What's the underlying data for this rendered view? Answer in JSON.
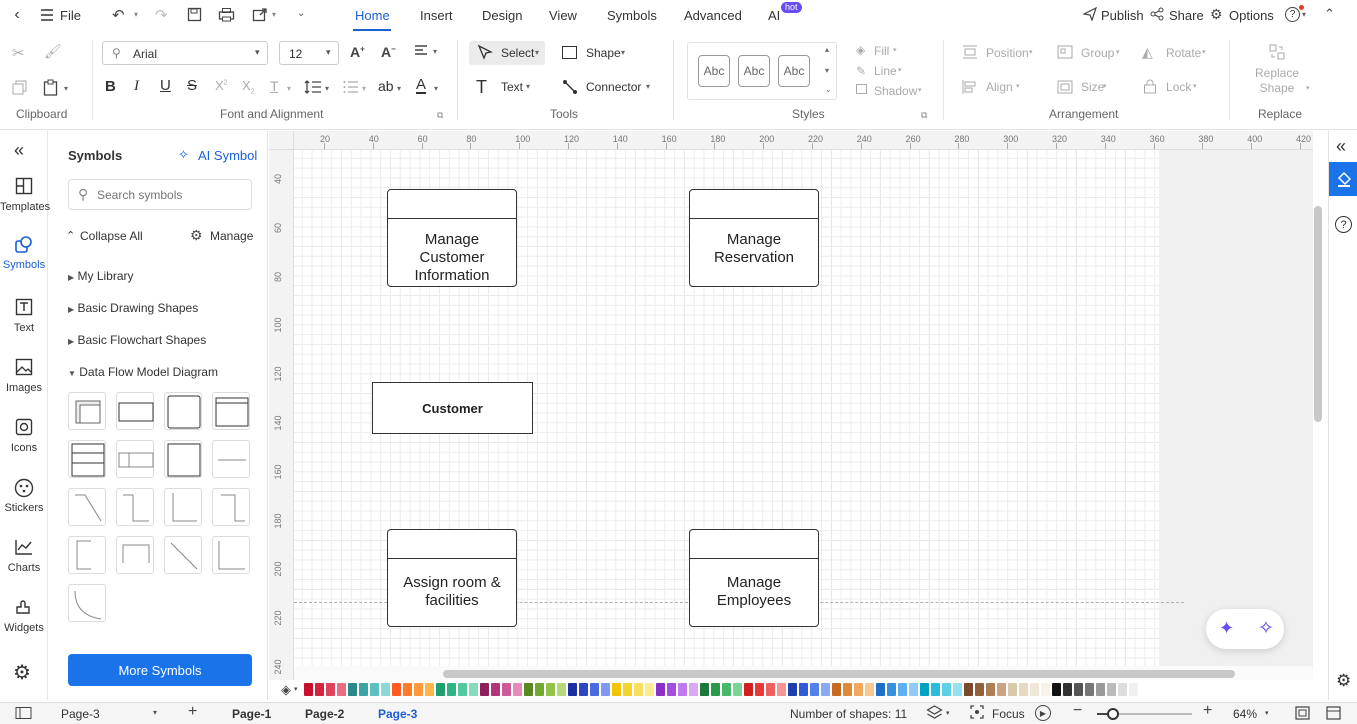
{
  "menubar": {
    "file": "File",
    "tabs": [
      "Home",
      "Insert",
      "Design",
      "View",
      "Symbols",
      "Advanced",
      "AI"
    ],
    "ai_badge": "hot",
    "publish": "Publish",
    "share": "Share",
    "options": "Options"
  },
  "ribbon": {
    "font": "Arial",
    "font_size": "12",
    "select": "Select",
    "shape": "Shape",
    "text": "Text",
    "connector": "Connector",
    "style_swatches": [
      "Abc",
      "Abc",
      "Abc"
    ],
    "fill": "Fill",
    "line": "Line",
    "shadow": "Shadow",
    "position": "Position",
    "group": "Group",
    "rotate": "Rotate",
    "align": "Align",
    "size": "Size",
    "lock": "Lock",
    "replace_shape": "Replace Shape",
    "groups": {
      "clipboard": "Clipboard",
      "font": "Font and Alignment",
      "tools": "Tools",
      "styles": "Styles",
      "arrangement": "Arrangement",
      "replace": "Replace"
    }
  },
  "leftnav": [
    "Templates",
    "Symbols",
    "Text",
    "Images",
    "Icons",
    "Stickers",
    "Charts",
    "Widgets"
  ],
  "symbols": {
    "title": "Symbols",
    "ai_symbol": "AI Symbol",
    "search_placeholder": "Search symbols",
    "collapse_all": "Collapse All",
    "manage": "Manage",
    "libraries": [
      "My Library",
      "Basic Drawing Shapes",
      "Basic Flowchart Shapes",
      "Data Flow Model Diagram"
    ],
    "more": "More Symbols"
  },
  "ruler": {
    "h": [
      "20",
      "40",
      "60",
      "80",
      "100",
      "120",
      "140",
      "160",
      "180",
      "200",
      "220",
      "240",
      "260",
      "280",
      "300",
      "320",
      "340",
      "360",
      "380",
      "400",
      "420"
    ],
    "v": [
      "40",
      "60",
      "80",
      "100",
      "120",
      "140",
      "160",
      "180",
      "200",
      "220",
      "240"
    ]
  },
  "diagram": {
    "shapes": [
      "Manage Customer Information",
      "Manage Reservation",
      "Customer",
      "Assign room & facilities",
      "Manage Employees"
    ]
  },
  "colors": [
    "#c8102e",
    "#d6243f",
    "#e0435c",
    "#ea6d84",
    "#2a8a8a",
    "#3aa3a3",
    "#5cc0c0",
    "#8fd8d8",
    "#ff5a1f",
    "#ff7a2a",
    "#ff9a3c",
    "#ffb54d",
    "#1f9e6e",
    "#2fb583",
    "#52c99c",
    "#86dcbb",
    "#8e1f5a",
    "#b0357a",
    "#cf5a9a",
    "#e68ab9",
    "#5a8a1f",
    "#74a82e",
    "#92c24a",
    "#b5d97a",
    "#1d2fa0",
    "#2d47c4",
    "#4d6be0",
    "#8099ef",
    "#f2c500",
    "#f5d32e",
    "#f8e05c",
    "#fbec94",
    "#8a2fc8",
    "#a44ee0",
    "#bf7af0",
    "#d9a8f7",
    "#1a7a3a",
    "#2a9a4e",
    "#48b86a",
    "#7dd497",
    "#d21f1f",
    "#e63a3a",
    "#f06060",
    "#f79494",
    "#1e40af",
    "#2f5bd6",
    "#5480ec",
    "#8aa9f5",
    "#c66b1f",
    "#dd8a3a",
    "#ee a95e",
    "#f6c892",
    "#1f6fc8",
    "#3590e0",
    "#5eaef0",
    "#92cbf7",
    "#00a3c4",
    "#2cbcd9",
    "#5dd0e6",
    "#94e2f0",
    "#7a4a2a",
    "#94603a",
    "#b07e55",
    "#cba382",
    "#d9c9a8",
    "#e6d9bf",
    "#f0e8d6",
    "#f8f3e8",
    "#111111",
    "#333333",
    "#555555",
    "#777777",
    "#999999",
    "#bbbbbb",
    "#dddddd",
    "#f0f0f0"
  ],
  "statusbar": {
    "page_select": "Page-3",
    "pages": [
      "Page-1",
      "Page-2",
      "Page-3"
    ],
    "shape_count": "Number of shapes: 11",
    "focus": "Focus",
    "zoom": "64%"
  }
}
